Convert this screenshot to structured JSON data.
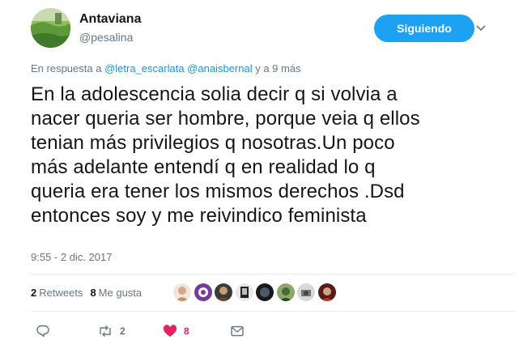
{
  "tweet": {
    "display_name": "Antaviana",
    "handle": "@pesalina",
    "follow_label": "Siguiendo",
    "reply_prefix": "En respuesta a",
    "reply_mentions": [
      "@letra_escarlata",
      "@anaisbernal"
    ],
    "reply_conj": "y",
    "reply_more": "a 9 más",
    "text_lines": [
      "En la adolescencia solia decir q si volvia a",
      "nacer queria ser hombre, porque veia q ellos",
      "tenian más privilegios q nosotras.Un poco",
      "más adelante entendí q en realidad lo q",
      "queria era tener los mismos derechos .Dsd",
      "entonces soy y me reivindico feminista"
    ],
    "timestamp": "9:55 - 2 dic. 2017"
  },
  "stats": {
    "retweets_count": "2",
    "retweets_label": "Retweets",
    "likes_count": "8",
    "likes_label": "Me gusta"
  },
  "actions": {
    "reply_count": "",
    "retweet_count": "2",
    "like_count": "8"
  },
  "colors": {
    "accent": "#1da1f2",
    "like": "#e0245e",
    "muted": "#657786",
    "text": "#14171a"
  },
  "icons": [
    "reply-icon",
    "retweet-icon",
    "heart-icon",
    "message-icon",
    "chevron-down-icon"
  ]
}
